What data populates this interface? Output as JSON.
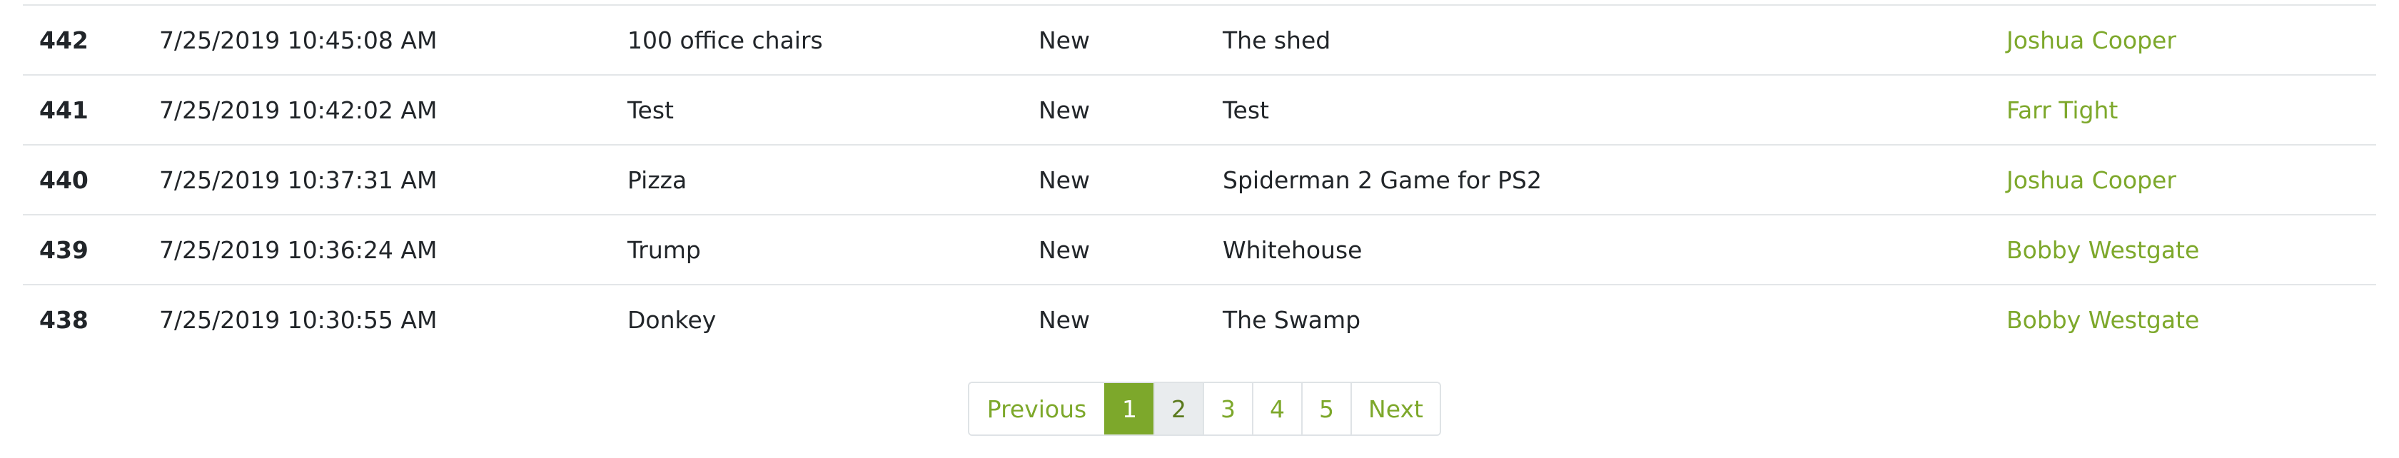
{
  "colors": {
    "accent": "#7da82b",
    "row_divider": "#e3e6e8",
    "hover_bg": "#e9ecee"
  },
  "orders": [
    {
      "id": "442",
      "date": "7/25/2019 10:45:08 AM",
      "item": "100 office chairs",
      "status": "New",
      "location": "The shed",
      "user": "Joshua Cooper"
    },
    {
      "id": "441",
      "date": "7/25/2019 10:42:02 AM",
      "item": "Test",
      "status": "New",
      "location": "Test",
      "user": "Farr Tight"
    },
    {
      "id": "440",
      "date": "7/25/2019 10:37:31 AM",
      "item": "Pizza",
      "status": "New",
      "location": "Spiderman 2 Game for PS2",
      "user": "Joshua Cooper"
    },
    {
      "id": "439",
      "date": "7/25/2019 10:36:24 AM",
      "item": "Trump",
      "status": "New",
      "location": "Whitehouse",
      "user": "Bobby Westgate"
    },
    {
      "id": "438",
      "date": "7/25/2019 10:30:55 AM",
      "item": "Donkey",
      "status": "New",
      "location": "The Swamp",
      "user": "Bobby Westgate"
    }
  ],
  "pagination": {
    "previous_label": "Previous",
    "next_label": "Next",
    "pages": [
      "1",
      "2",
      "3",
      "4",
      "5"
    ],
    "current_page": "1",
    "hovered_page": "2"
  }
}
